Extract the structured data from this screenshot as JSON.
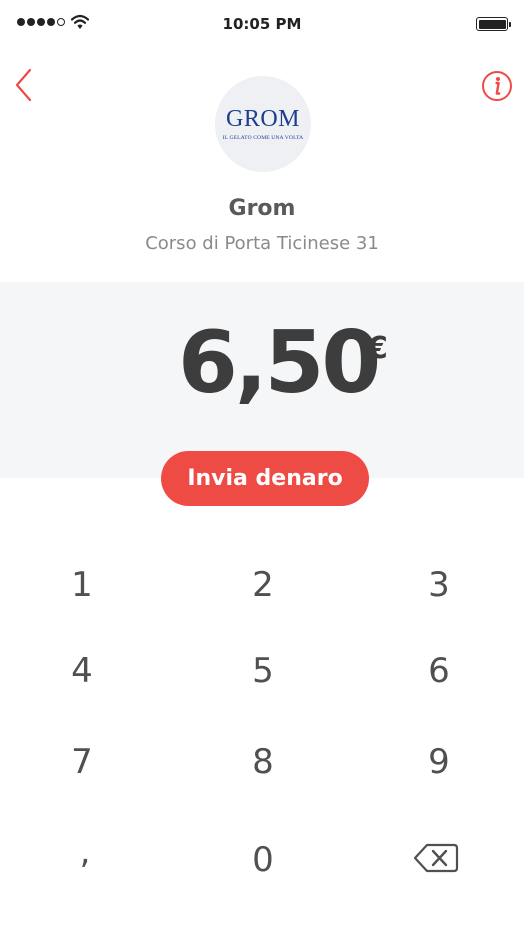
{
  "status_bar": {
    "time": "10:05 PM",
    "signal_icon": "signal-dots-icon",
    "wifi_icon": "wifi-icon",
    "battery_icon": "battery-icon"
  },
  "header": {
    "back_icon": "chevron-left-icon",
    "info_icon": "info-circle-icon",
    "accent_color": "#ef4b45"
  },
  "merchant": {
    "logo_text": "GROM",
    "logo_tagline": "IL GELATO COME UNA VOLTA",
    "name": "Grom",
    "address": "Corso di Porta Ticinese 31"
  },
  "payment": {
    "amount": "6,50",
    "currency": "€",
    "send_label": "Invia denaro",
    "button_color": "#ef4b45"
  },
  "keypad": {
    "keys": [
      "1",
      "2",
      "3",
      "4",
      "5",
      "6",
      "7",
      "8",
      "9",
      ",",
      "0"
    ],
    "backspace_icon": "backspace-icon"
  }
}
